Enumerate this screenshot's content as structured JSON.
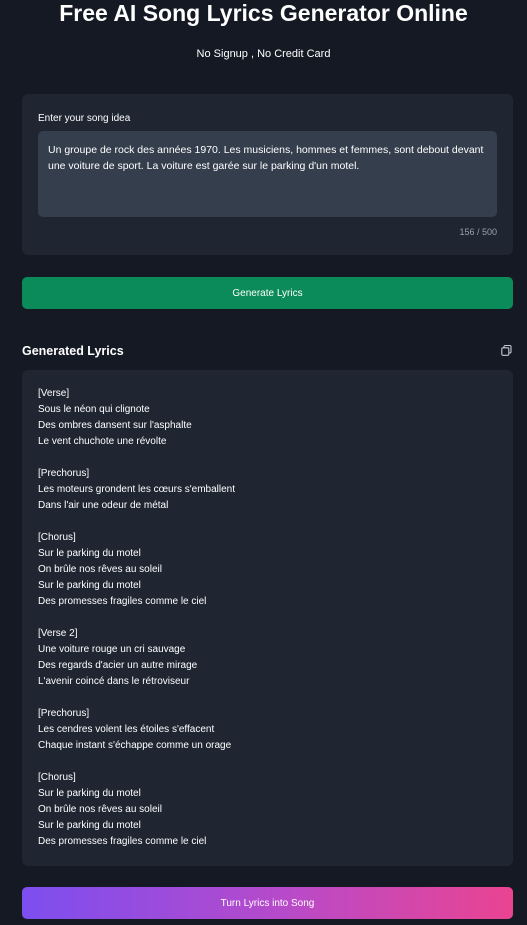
{
  "header": {
    "title": "Free AI Song Lyrics Generator Online",
    "subtitle": "No Signup , No Credit Card"
  },
  "input": {
    "label": "Enter your song idea",
    "value": "Un groupe de rock des années 1970. Les musiciens, hommes et femmes, sont debout devant une voiture de sport. La voiture est garée sur le parking d'un motel.",
    "counter": "156 / 500"
  },
  "actions": {
    "generate_label": "Generate Lyrics",
    "song_label": "Turn Lyrics into Song"
  },
  "output": {
    "title": "Generated Lyrics",
    "copy_icon": "copy-icon",
    "lyrics": "[Verse]\nSous le néon qui clignote\nDes ombres dansent sur l'asphalte\nLe vent chuchote une révolte\n\n[Prechorus]\nLes moteurs grondent les cœurs s'emballent\nDans l'air une odeur de métal\n\n[Chorus]\nSur le parking du motel\nOn brûle nos rêves au soleil\nSur le parking du motel\nDes promesses fragiles comme le ciel\n\n[Verse 2]\nUne voiture rouge un cri sauvage\nDes regards d'acier un autre mirage\nL'avenir coincé dans le rétroviseur\n\n[Prechorus]\nLes cendres volent les étoiles s'effacent\nChaque instant s'échappe comme un orage\n\n[Chorus]\nSur le parking du motel\nOn brûle nos rêves au soleil\nSur le parking du motel\nDes promesses fragiles comme le ciel"
  },
  "colors": {
    "background": "#141923",
    "card": "#1f2632",
    "textarea": "#353e4c",
    "generate_button": "#0b8b5a",
    "gradient_start": "#7c4ef0",
    "gradient_end": "#ea4491"
  }
}
